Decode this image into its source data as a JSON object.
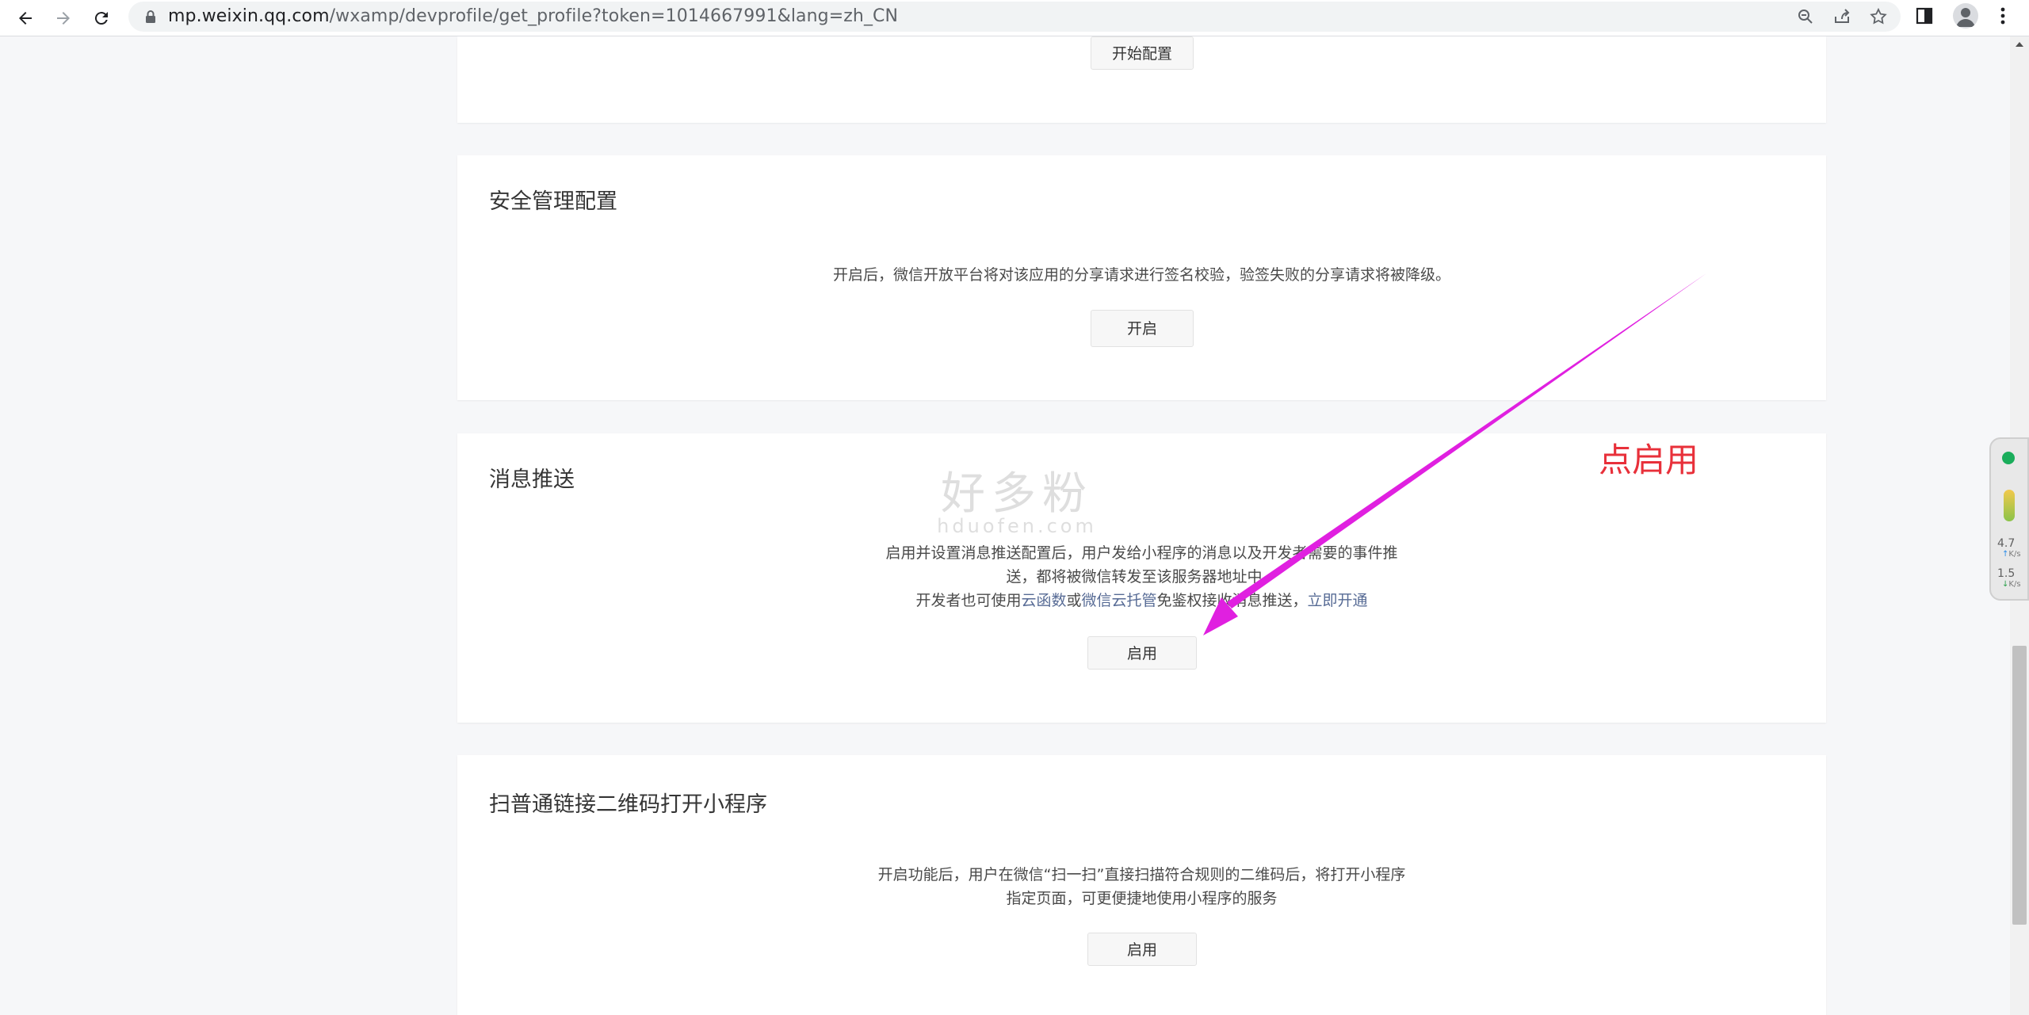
{
  "browser": {
    "url_host": "mp.weixin.qq.com",
    "url_path": "/wxamp/devprofile/get_profile?token=1014667991&lang=zh_CN"
  },
  "cards": {
    "top_partial": {
      "button_label": "开始配置"
    },
    "security": {
      "title": "安全管理配置",
      "description": "开启后，微信开放平台将对该应用的分享请求进行签名校验，验签失败的分享请求将被降级。",
      "button_label": "开启"
    },
    "message_push": {
      "title": "消息推送",
      "desc_line1": "启用并设置消息推送配置后，用户发给小程序的消息以及开发者需要的事件推",
      "desc_line2": "送，都将被微信转发至该服务器地址中。",
      "desc_line3_prefix": "开发者也可使用",
      "link_cloud_function": "云函数",
      "desc_line3_or": "或",
      "link_cloud_hosting": "微信云托管",
      "desc_line3_suffix": "免鉴权接收消息推送，",
      "link_enable_now": "立即开通",
      "button_label": "启用"
    },
    "qrcode": {
      "title": "扫普通链接二维码打开小程序",
      "desc_line1": "开启功能后，用户在微信“扫一扫”直接扫描符合规则的二维码后，将打开小程序",
      "desc_line2": "指定页面，可更便捷地使用小程序的服务",
      "button_label": "启用"
    }
  },
  "annotation": {
    "label": "点启用",
    "color": "#e8303a",
    "arrow_color": "#e020e0"
  },
  "watermark": {
    "text_cn": "好多粉",
    "text_en": "hduofen.com"
  },
  "network_widget": {
    "upload_value": "4.7",
    "upload_unit": "K/s",
    "download_value": "1.5",
    "download_unit": "K/s"
  }
}
